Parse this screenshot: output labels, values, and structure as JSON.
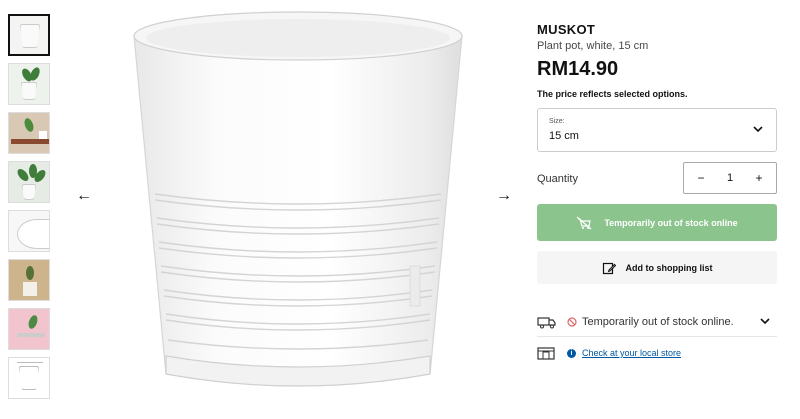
{
  "product": {
    "name": "MUSKOT",
    "description": "Plant pot, white, 15 cm",
    "price": "RM14.90",
    "price_note": "The price reflects selected options."
  },
  "size": {
    "label": "Size:",
    "value": "15 cm"
  },
  "quantity": {
    "label": "Quantity",
    "value": "1",
    "decrement": "−",
    "increment": "+"
  },
  "buttons": {
    "out_of_stock": "Temporarily out of stock online",
    "add_to_list": "Add to shopping list"
  },
  "availability": {
    "delivery_status": "Temporarily out of stock online.",
    "store_link": "Check at your local store"
  },
  "navigation": {
    "prev_arrow": "←",
    "next_arrow": "→"
  },
  "thumbnails": [
    {
      "name": "thumbnail-pot-white",
      "kind": "pot"
    },
    {
      "name": "thumbnail-pot-with-plant",
      "kind": "plant"
    },
    {
      "name": "thumbnail-table-scene",
      "kind": "scene"
    },
    {
      "name": "thumbnail-plant-closeup",
      "kind": "plant"
    },
    {
      "name": "thumbnail-pot-detail",
      "kind": "pot"
    },
    {
      "name": "thumbnail-room-scene",
      "kind": "scene"
    },
    {
      "name": "thumbnail-pink-scene",
      "kind": "pink"
    },
    {
      "name": "thumbnail-dimensions",
      "kind": "pot"
    }
  ],
  "colors": {
    "accent_blue": "#0058a3",
    "disabled_green": "#8cc48e",
    "out_of_stock_red": "#e06666"
  }
}
